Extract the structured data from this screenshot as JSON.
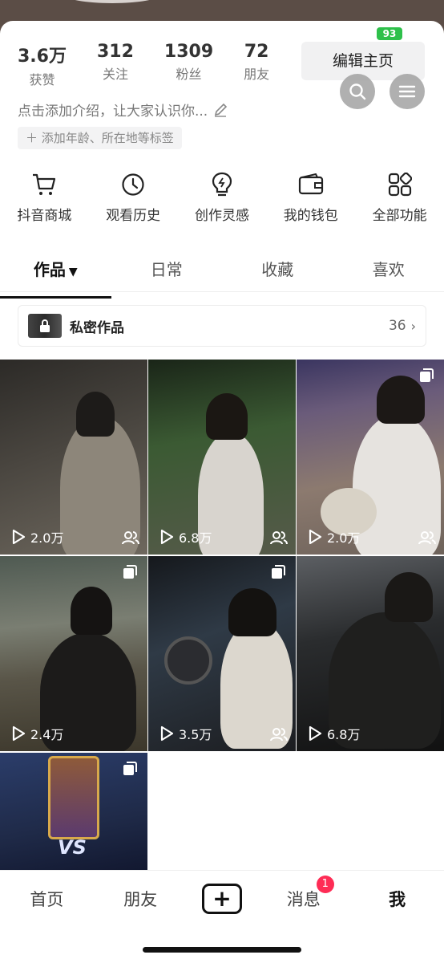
{
  "status": {
    "battery": "93"
  },
  "profile": {
    "stats": [
      {
        "value": "3.6万",
        "label": "获赞"
      },
      {
        "value": "312",
        "label": "关注"
      },
      {
        "value": "1309",
        "label": "粉丝"
      },
      {
        "value": "72",
        "label": "朋友"
      }
    ],
    "edit_label": "编辑主页",
    "bio_placeholder": "点击添加介绍，让大家认识你...",
    "tag_label": "添加年龄、所在地等标签"
  },
  "functions": [
    {
      "label": "抖音商城",
      "icon": "cart-icon"
    },
    {
      "label": "观看历史",
      "icon": "clock-icon"
    },
    {
      "label": "创作灵感",
      "icon": "lightbulb-icon"
    },
    {
      "label": "我的钱包",
      "icon": "wallet-icon"
    },
    {
      "label": "全部功能",
      "icon": "grid-icon"
    }
  ],
  "tabs": [
    {
      "label": "作品",
      "active": true
    },
    {
      "label": "日常"
    },
    {
      "label": "收藏"
    },
    {
      "label": "喜欢"
    }
  ],
  "private_works": {
    "label": "私密作品",
    "count": "36"
  },
  "videos": [
    {
      "plays": "2.0万",
      "friends": true
    },
    {
      "plays": "6.8万",
      "friends": true
    },
    {
      "plays": "2.0万",
      "friends": true,
      "multi": true
    },
    {
      "plays": "2.4万",
      "multi": true
    },
    {
      "plays": "3.5万",
      "friends": true,
      "multi": true
    },
    {
      "plays": "6.8万"
    },
    {
      "plays": "",
      "multi": true,
      "game_text": "VS"
    }
  ],
  "bottom_nav": [
    {
      "label": "首页"
    },
    {
      "label": "朋友"
    },
    {
      "label": "+"
    },
    {
      "label": "消息",
      "badge": "1"
    },
    {
      "label": "我",
      "active": true
    }
  ]
}
